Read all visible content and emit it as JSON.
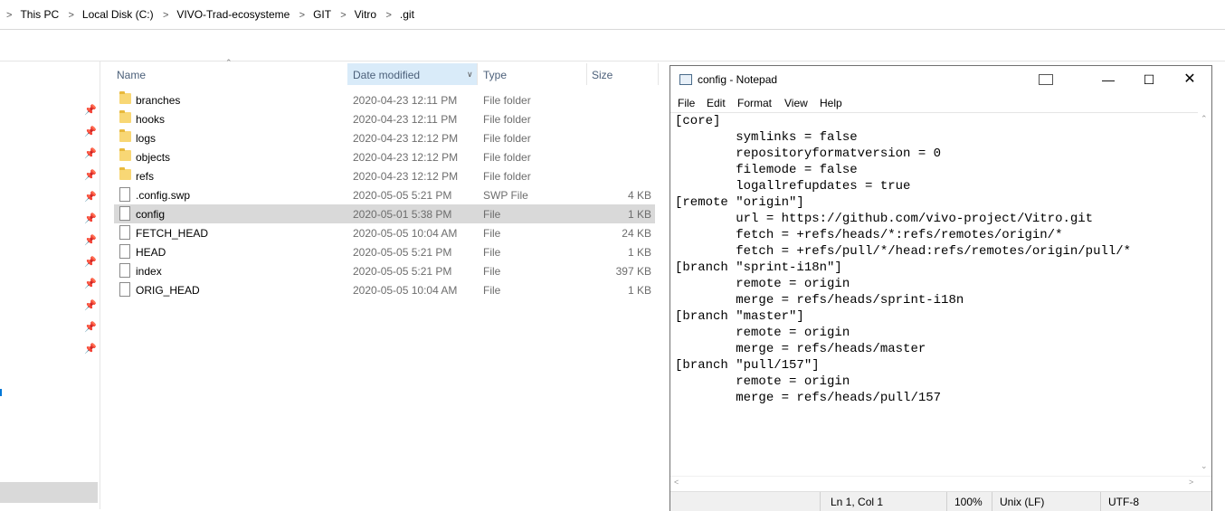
{
  "breadcrumb": [
    "This PC",
    "Local Disk (C:)",
    "VIVO-Trad-ecosysteme",
    "GIT",
    "Vitro",
    ".git"
  ],
  "columns": {
    "name": "Name",
    "date": "Date modified",
    "type": "Type",
    "size": "Size"
  },
  "files": [
    {
      "name": "branches",
      "date": "2020-04-23 12:11 PM",
      "type": "File folder",
      "size": "",
      "kind": "folder"
    },
    {
      "name": "hooks",
      "date": "2020-04-23 12:11 PM",
      "type": "File folder",
      "size": "",
      "kind": "folder"
    },
    {
      "name": "logs",
      "date": "2020-04-23 12:12 PM",
      "type": "File folder",
      "size": "",
      "kind": "folder"
    },
    {
      "name": "objects",
      "date": "2020-04-23 12:12 PM",
      "type": "File folder",
      "size": "",
      "kind": "folder"
    },
    {
      "name": "refs",
      "date": "2020-04-23 12:12 PM",
      "type": "File folder",
      "size": "",
      "kind": "folder"
    },
    {
      "name": ".config.swp",
      "date": "2020-05-05 5:21 PM",
      "type": "SWP File",
      "size": "4 KB",
      "kind": "file"
    },
    {
      "name": "config",
      "date": "2020-05-01 5:38 PM",
      "type": "File",
      "size": "1 KB",
      "kind": "file",
      "selected": true
    },
    {
      "name": "FETCH_HEAD",
      "date": "2020-05-05 10:04 AM",
      "type": "File",
      "size": "24 KB",
      "kind": "file"
    },
    {
      "name": "HEAD",
      "date": "2020-05-05 5:21 PM",
      "type": "File",
      "size": "1 KB",
      "kind": "file"
    },
    {
      "name": "index",
      "date": "2020-05-05 5:21 PM",
      "type": "File",
      "size": "397 KB",
      "kind": "file"
    },
    {
      "name": "ORIG_HEAD",
      "date": "2020-05-05 10:04 AM",
      "type": "File",
      "size": "1 KB",
      "kind": "file"
    }
  ],
  "notepad": {
    "title": "config - Notepad",
    "menu": [
      "File",
      "Edit",
      "Format",
      "View",
      "Help"
    ],
    "lines": [
      "[core]",
      "        symlinks = false",
      "        repositoryformatversion = 0",
      "        filemode = false",
      "        logallrefupdates = true",
      "[remote \"origin\"]",
      "        url = https://github.com/vivo-project/Vitro.git",
      "        fetch = +refs/heads/*:refs/remotes/origin/*",
      "        fetch = +refs/pull/*/head:refs/remotes/origin/pull/*",
      "[branch \"sprint-i18n\"]",
      "        remote = origin",
      "        merge = refs/heads/sprint-i18n",
      "[branch \"master\"]",
      "        remote = origin",
      "        merge = refs/heads/master",
      "[branch \"pull/157\"]",
      "        remote = origin",
      "        merge = refs/heads/pull/157"
    ],
    "status": {
      "position": "Ln 1, Col 1",
      "zoom": "100%",
      "eol": "Unix (LF)",
      "encoding": "UTF-8"
    }
  }
}
